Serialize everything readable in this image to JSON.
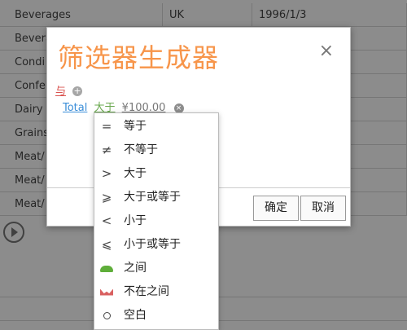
{
  "grid": {
    "rows": [
      {
        "category": "Beverages",
        "country": "UK",
        "date": "1996/1/3"
      },
      {
        "category": "Bevera",
        "country": "",
        "date": ""
      },
      {
        "category": "Condi",
        "country": "",
        "date": ""
      },
      {
        "category": "Confe",
        "country": "",
        "date": ""
      },
      {
        "category": "Dairy",
        "country": "",
        "date": ""
      },
      {
        "category": "Grains",
        "country": "",
        "date": ""
      },
      {
        "category": "Meat/",
        "country": "",
        "date": ""
      },
      {
        "category": "Meat/",
        "country": "",
        "date": ""
      },
      {
        "category": "Meat/",
        "country": "",
        "date": ""
      }
    ]
  },
  "dialog": {
    "title": "筛选器生成器",
    "close_icon": "×",
    "logic_label": "与",
    "add_icon": "+",
    "condition": {
      "field": "Total",
      "operator": "大于",
      "value": "¥100.00",
      "remove_icon": "×"
    },
    "ok_label": "确定",
    "cancel_label": "取消"
  },
  "dropdown": {
    "items": [
      {
        "icon": "=",
        "label": "等于"
      },
      {
        "icon": "≠",
        "label": "不等于"
      },
      {
        "icon": ">",
        "label": "大于"
      },
      {
        "icon": "⩾",
        "label": "大于或等于"
      },
      {
        "icon": "<",
        "label": "小于"
      },
      {
        "icon": "⩽",
        "label": "小于或等于"
      },
      {
        "icon": "between-icon",
        "label": "之间"
      },
      {
        "icon": "not-between-icon",
        "label": "不在之间"
      },
      {
        "icon": "blank-icon",
        "label": "空白"
      }
    ]
  }
}
